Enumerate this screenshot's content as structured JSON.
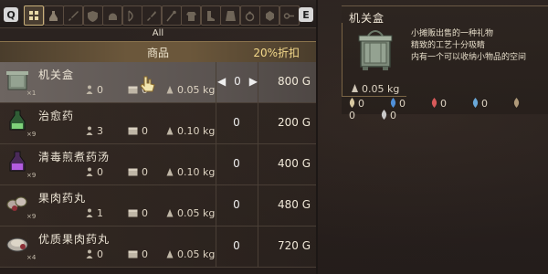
{
  "controls": {
    "q_key": "Q",
    "e_key": "E"
  },
  "tabs": [
    {
      "icon": "grid-icon",
      "active": true
    },
    {
      "icon": "potion-icon"
    },
    {
      "icon": "sword-icon"
    },
    {
      "icon": "shield-icon"
    },
    {
      "icon": "helmet-icon"
    },
    {
      "icon": "bow-icon"
    },
    {
      "icon": "dagger-icon"
    },
    {
      "icon": "staff-icon"
    },
    {
      "icon": "armor-icon"
    },
    {
      "icon": "boots-icon"
    },
    {
      "icon": "cape-icon"
    },
    {
      "icon": "ring-icon"
    },
    {
      "icon": "material-icon"
    },
    {
      "icon": "key-icon"
    }
  ],
  "category_label": "All",
  "shop": {
    "header_title": "商品",
    "discount": "20%折扣",
    "items": [
      {
        "name": "机关盒",
        "qty": "×1",
        "owned": "0",
        "stored": "0",
        "weight": "0.05 kg",
        "count": "0",
        "price": "800 G",
        "selected": true
      },
      {
        "name": "治愈药",
        "qty": "×9",
        "owned": "3",
        "stored": "0",
        "weight": "0.10 kg",
        "count": "0",
        "price": "200 G"
      },
      {
        "name": "清毒煎煮药汤",
        "qty": "×9",
        "owned": "0",
        "stored": "0",
        "weight": "0.10 kg",
        "count": "0",
        "price": "400 G"
      },
      {
        "name": "果肉药丸",
        "qty": "×9",
        "owned": "1",
        "stored": "0",
        "weight": "0.05 kg",
        "count": "0",
        "price": "480 G"
      },
      {
        "name": "优质果肉药丸",
        "qty": "×4",
        "owned": "0",
        "stored": "0",
        "weight": "0.05 kg",
        "count": "0",
        "price": "720 G"
      }
    ]
  },
  "detail": {
    "title": "机关盒",
    "description": [
      "小摊贩出售的一种礼物",
      "精致的工艺十分吸睛",
      "内有一个可以收纳小物品的空间"
    ],
    "weight": "0.05 kg",
    "resistances": [
      "0",
      "0",
      "0",
      "0",
      "0",
      "0"
    ]
  }
}
